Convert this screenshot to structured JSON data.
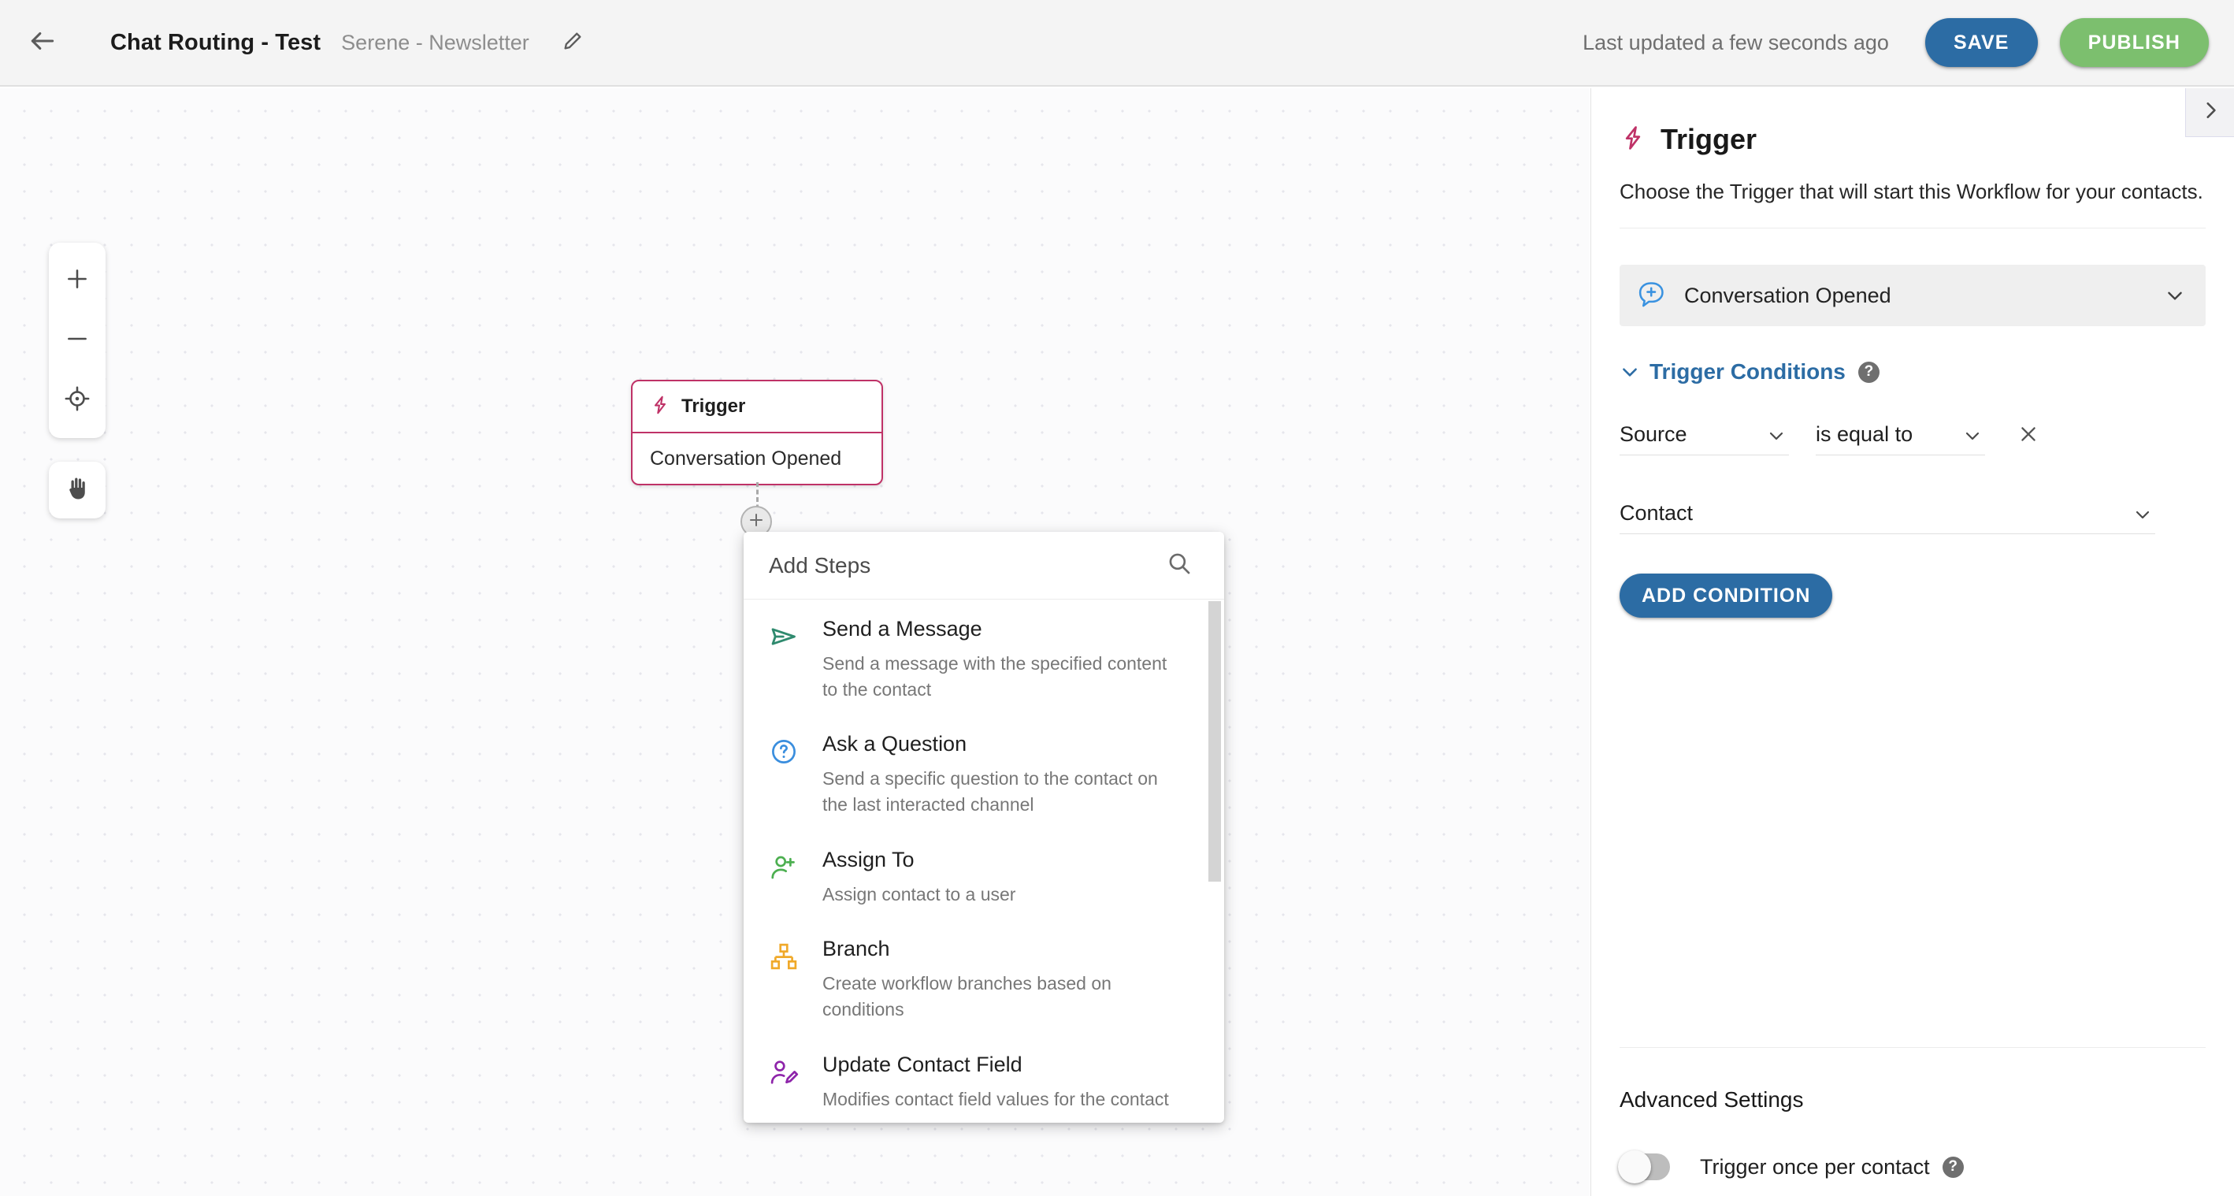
{
  "header": {
    "back_icon": "arrow-left-icon",
    "title": "Chat Routing - Test",
    "subtitle": "Serene - Newsletter",
    "edit_icon": "pencil-icon",
    "last_updated": "Last updated a few seconds ago",
    "save_label": "SAVE",
    "publish_label": "PUBLISH",
    "save_color": "#2c6ca4",
    "publish_color": "#7cbf6e"
  },
  "canvas": {
    "zoom_in_icon": "plus-icon",
    "zoom_out_icon": "minus-icon",
    "recenter_icon": "crosshair-icon",
    "pan_icon": "hand-icon",
    "panel_toggle_icon": "chevron-right-icon",
    "trigger_node": {
      "icon": "lightning-bolt-icon",
      "header_label": "Trigger",
      "body_label": "Conversation Opened",
      "border_color": "#bf3267"
    },
    "add_node_icon": "plus-circle-icon"
  },
  "add_steps": {
    "title": "Add Steps",
    "search_icon": "search-icon",
    "items": [
      {
        "icon": "send-paper-plane-icon",
        "icon_color": "#2f8a6e",
        "title": "Send a Message",
        "desc": "Send a message with the specified content to the contact"
      },
      {
        "icon": "question-circle-icon",
        "icon_color": "#3a8ede",
        "title": "Ask a Question",
        "desc": "Send a specific question to the contact on the last interacted channel"
      },
      {
        "icon": "user-plus-icon",
        "icon_color": "#4caf50",
        "title": "Assign To",
        "desc": "Assign contact to a user"
      },
      {
        "icon": "sitemap-branch-icon",
        "icon_color": "#f0a92a",
        "title": "Branch",
        "desc": "Create workflow branches based on conditions"
      },
      {
        "icon": "user-edit-icon",
        "icon_color": "#8e24aa",
        "title": "Update Contact Field",
        "desc": "Modifies contact field values for the contact"
      }
    ]
  },
  "right_panel": {
    "icon": "lightning-bolt-icon",
    "title": "Trigger",
    "description": "Choose the Trigger that will start this Workflow for your contacts.",
    "trigger_select": {
      "icon": "conversation-plus-icon",
      "value": "Conversation Opened",
      "chevron_icon": "chevron-down-icon"
    },
    "conditions": {
      "chevron_icon": "chevron-down-icon",
      "title": "Trigger Conditions",
      "help_icon": "?",
      "rows": [
        {
          "field_value": "Source",
          "operator_value": "is equal to",
          "remove_icon": "close-x-icon"
        }
      ],
      "contact_value": "Contact",
      "add_condition_label": "ADD CONDITION"
    },
    "advanced": {
      "title": "Advanced Settings",
      "toggle_label": "Trigger once per contact",
      "toggle_on": false,
      "help_icon": "?"
    }
  }
}
